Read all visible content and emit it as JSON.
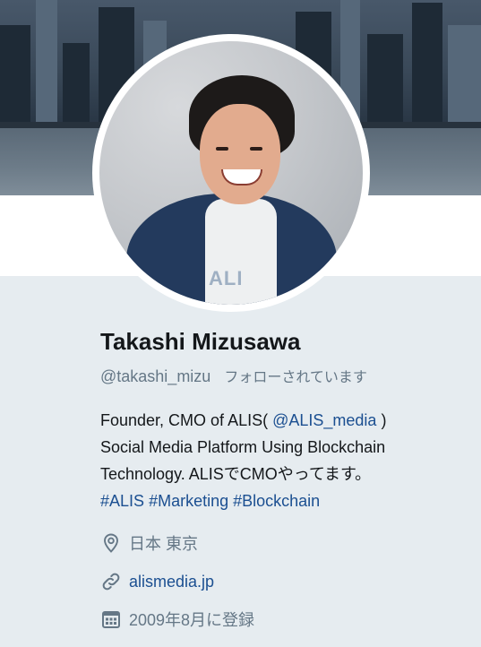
{
  "profile": {
    "name": "Takashi Mizusawa",
    "handle": "@takashi_mizu",
    "follows_you": "フォローされています",
    "shirt_print": "ALI",
    "bio": {
      "line1_prefix": "Founder, CMO of ALIS( ",
      "line1_mention": "@ALIS_media",
      "line1_suffix": " )",
      "line2": "Social Media Platform Using Blockchain",
      "line3": "Technology. ALISでCMOやってます。",
      "hashtag1": "#ALIS",
      "hashtag2": "#Marketing",
      "hashtag3": "#Blockchain"
    },
    "location": "日本 東京",
    "website": "alismedia.jp",
    "joined": "2009年8月に登録"
  },
  "icons": {
    "location": "location-pin-icon",
    "website": "link-icon",
    "joined": "calendar-icon"
  },
  "colors": {
    "background": "#e6ecf0",
    "link": "#1b4f91",
    "secondary_text": "#657786",
    "primary_text": "#14171a"
  }
}
